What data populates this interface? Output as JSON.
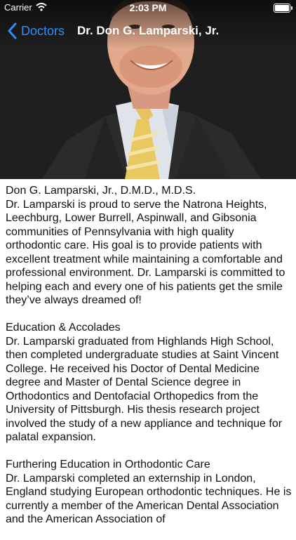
{
  "status_bar": {
    "carrier": "Carrier",
    "time": "2:03 PM",
    "icons": [
      "wifi-icon",
      "battery-icon"
    ]
  },
  "nav": {
    "back_label": "Doctors",
    "title": "Dr. Don G. Lamparski, Jr.",
    "accent_color": "#2f8ef4"
  },
  "hero": {
    "image": "doctor-portrait"
  },
  "content": {
    "intro_title": "Don G. Lamparski, Jr., D.M.D., M.D.S.",
    "intro_body": "Dr. Lamparski is proud to serve the Natrona Heights, Leechburg, Lower Burrell, Aspinwall, and Gibsonia communities of Pennsylvania with high quality orthodontic care. His goal is to provide patients with excellent treatment while maintaining a comfortable and professional environment. Dr. Lamparski is committed to helping each and every one of his patients get the smile they’ve always dreamed of!",
    "education_title": "Education & Accolades",
    "education_body": "Dr. Lamparski graduated from Highlands High School, then completed undergraduate studies at Saint Vincent College. He received his Doctor of Dental Medicine degree and Master of Dental Science degree in Orthodontics and Dentofacial Orthopedics from the University of Pittsburgh. His thesis research project involved the study of a new appliance and technique for palatal expansion.",
    "furthering_title": "Furthering Education in Orthodontic Care",
    "furthering_body": "Dr. Lamparski completed an externship in London, England studying European orthodontic techniques. He is currently a member of the American Dental Association and the American Association of"
  }
}
